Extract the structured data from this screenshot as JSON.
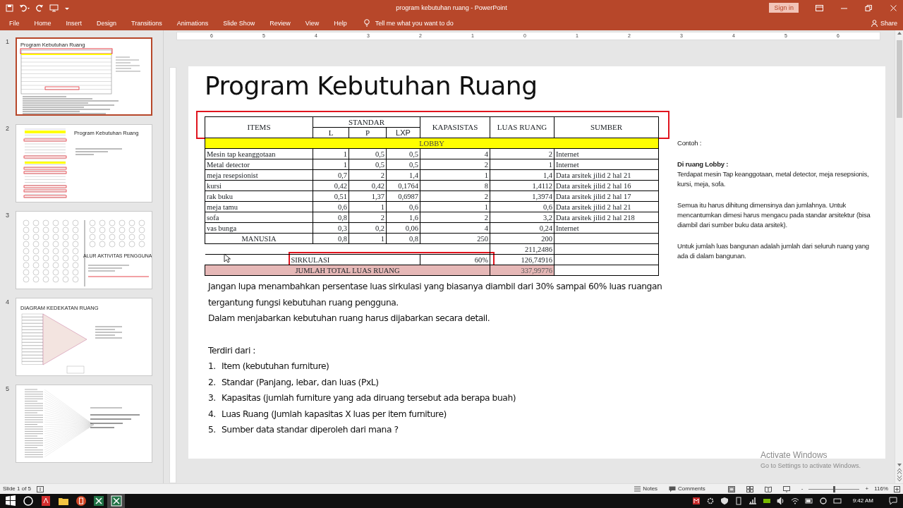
{
  "title_bar": {
    "title": "program kebutuhan ruang  -  PowerPoint",
    "sign_in": "Sign in"
  },
  "ribbon_tabs": [
    "File",
    "Home",
    "Insert",
    "Design",
    "Transitions",
    "Animations",
    "Slide Show",
    "Review",
    "View",
    "Help"
  ],
  "tell_me": "Tell me what you want to do",
  "share": "Share",
  "horizontal_ruler": [
    "6",
    "5",
    "4",
    "3",
    "2",
    "1",
    "0",
    "1",
    "2",
    "3",
    "4",
    "5",
    "6"
  ],
  "thumbnails": [
    {
      "number": "1",
      "title": "Program Kebutuhan Ruang",
      "kind": "table",
      "selected": true
    },
    {
      "number": "2",
      "title": "Program Kebutuhan Ruang",
      "kind": "tables",
      "selected": false
    },
    {
      "number": "3",
      "title": "ALUR AKTIVITAS PENGGUNA",
      "kind": "bubbles",
      "selected": false
    },
    {
      "number": "4",
      "title": "DIAGRAM  KEDEKATAN  RUANG",
      "kind": "matrix",
      "selected": false
    },
    {
      "number": "5",
      "kind": "tree",
      "selected": false
    }
  ],
  "slide": {
    "title": "Program Kebutuhan Ruang",
    "table": {
      "header_highlighted": true,
      "columns": {
        "items": "ITEMS",
        "standar": "STANDAR",
        "l": "L",
        "p": "P",
        "lxp": "LXP",
        "kapasitas": "KAPASISTAS",
        "luas_ruang": "LUAS RUANG",
        "sumber": "SUMBER"
      },
      "section": "LOBBY",
      "rows": [
        {
          "kind": "item",
          "items": "Mesin tap keanggotaan",
          "l": "1",
          "p": "0,5",
          "lxp": "0,5",
          "kapasitas": "4",
          "luas_ruang": "2",
          "sumber": "Internet"
        },
        {
          "kind": "item",
          "items": "Metal detector",
          "l": "1",
          "p": "0,5",
          "lxp": "0,5",
          "kapasitas": "2",
          "luas_ruang": "1",
          "sumber": "Internet"
        },
        {
          "kind": "item",
          "items": "meja resepsionist",
          "l": "0,7",
          "p": "2",
          "lxp": "1,4",
          "kapasitas": "1",
          "luas_ruang": "1,4",
          "sumber": "Data arsitek jilid 2 hal 21"
        },
        {
          "kind": "item",
          "items": "kursi",
          "l": "0,42",
          "p": "0,42",
          "lxp": "0,1764",
          "kapasitas": "8",
          "luas_ruang": "1,4112",
          "sumber": "Data arsitek jilid 2 hal 16"
        },
        {
          "kind": "item",
          "items": "rak buku",
          "l": "0,51",
          "p": "1,37",
          "lxp": "0,6987",
          "kapasitas": "2",
          "luas_ruang": "1,3974",
          "sumber": "Data arsitek jilid 2 hal 17"
        },
        {
          "kind": "item",
          "items": "meja tamu",
          "l": "0,6",
          "p": "1",
          "lxp": "0,6",
          "kapasitas": "1",
          "luas_ruang": "0,6",
          "sumber": "Data arsitek jilid 2 hal 21"
        },
        {
          "kind": "item",
          "items": "sofa",
          "l": "0,8",
          "p": "2",
          "lxp": "1,6",
          "kapasitas": "2",
          "luas_ruang": "3,2",
          "sumber": "Data arsitek jilid 2 hal 218"
        },
        {
          "kind": "item",
          "items": "vas bunga",
          "l": "0,3",
          "p": "0,2",
          "lxp": "0,06",
          "kapasitas": "4",
          "luas_ruang": "0,24",
          "sumber": "Internet"
        },
        {
          "kind": "group",
          "items": "MANUSIA",
          "l": "0,8",
          "p": "1",
          "lxp": "0,8",
          "kapasitas": "250",
          "luas_ruang": "200"
        }
      ],
      "subtotal": "211,2486",
      "sirkulasi": {
        "label": "SIRKULASI",
        "kapasitas": "60%",
        "luas_ruang": "126,74916",
        "highlighted": true
      },
      "total": {
        "label": "JUMLAH TOTAL LUAS RUANG",
        "luas_ruang": "337,99776"
      }
    },
    "paragraphs": [
      "Jangan lupa menambahkan persentase luas sirkulasi yang biasanya diambil dari 30% sampai 60% luas ruangan tergantung fungsi kebutuhan ruang pengguna.",
      "Dalam menjabarkan kebutuhan ruang harus dijabarkan secara detail."
    ],
    "list_heading": "Terdiri dari :",
    "list": [
      {
        "number": "1.",
        "text": "Item (kebutuhan furniture)"
      },
      {
        "number": "2.",
        "text": "Standar (Panjang, lebar, dan luas (PxL)"
      },
      {
        "number": "3.",
        "text": "Kapasitas (jumlah furniture yang ada diruang tersebut ada berapa buah)"
      },
      {
        "number": "4.",
        "text": "Luas Ruang (Jumlah kapasitas  X luas per item furniture)"
      },
      {
        "number": "5.",
        "text": "Sumber data standar diperoleh dari mana  ?"
      }
    ],
    "notes": {
      "label": "Contoh :",
      "heading": "Di ruang Lobby :",
      "paragraphs": [
        "Terdapat mesin Tap keanggotaan, metal detector, meja resepsionis, kursi, meja, sofa.",
        "Semua itu harus dihitung dimensinya dan jumlahnya. Untuk mencantumkan dimesi harus mengacu pada standar arsitektur (bisa diambil dari sumber buku data arsitek).",
        "Untuk jumlah luas bangunan adalah jumlah dari seluruh ruang yang ada di dalam bangunan."
      ]
    }
  },
  "activation": {
    "title": "Activate Windows",
    "subtitle": "Go to Settings to activate Windows."
  },
  "status_bar": {
    "slide": "Slide 1 of 5",
    "notes": "Notes",
    "comments": "Comments",
    "zoom": {
      "level": 0.49,
      "minus": "-",
      "plus": "+",
      "reading": "116%"
    }
  },
  "taskbar": {
    "time": "9:42 AM"
  }
}
